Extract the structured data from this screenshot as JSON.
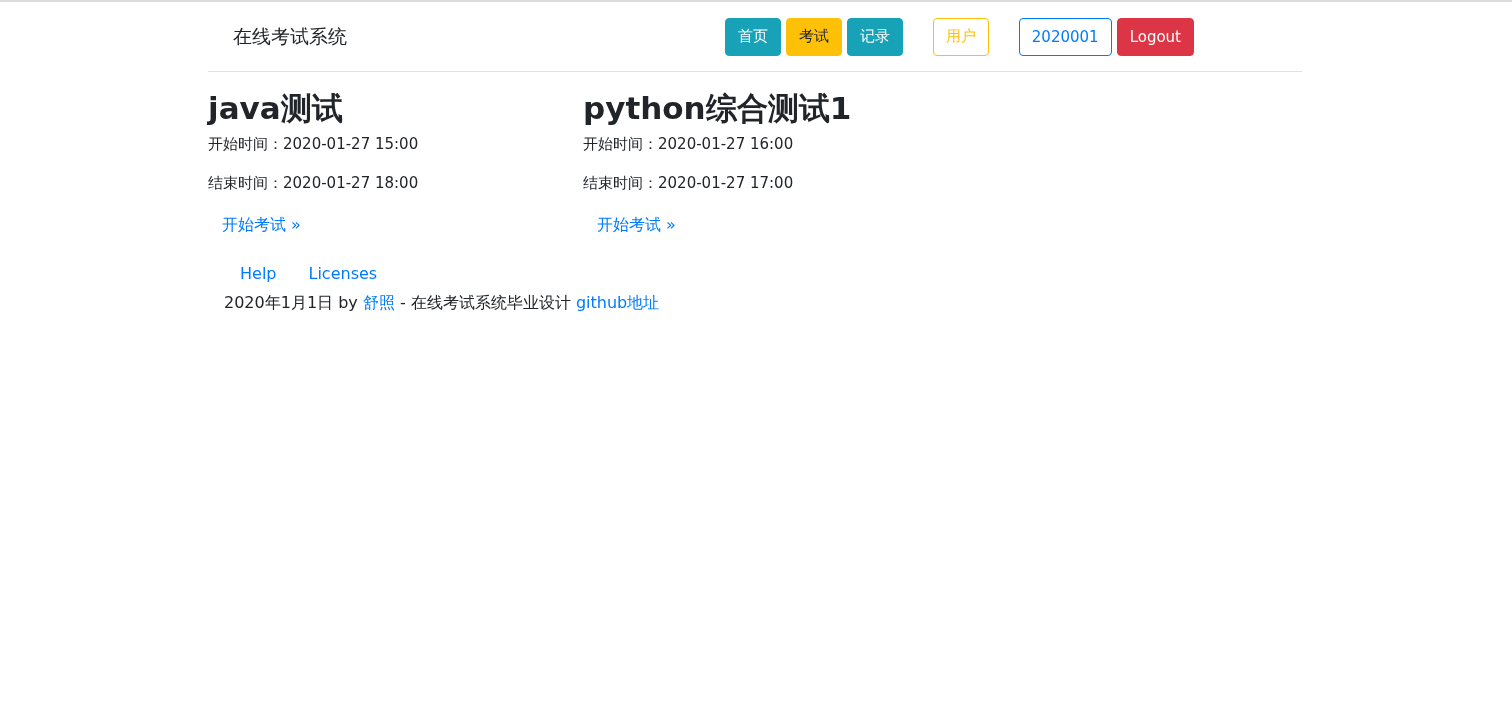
{
  "brand": "在线考试系统",
  "nav_groups": [
    [
      {
        "label": "首页"
      },
      {
        "label": "考试"
      },
      {
        "label": "记录"
      }
    ],
    [
      {
        "label": "用户"
      }
    ],
    [
      {
        "label": "2020001"
      },
      {
        "label": "Logout"
      }
    ]
  ],
  "exams": [
    {
      "title": "java测试",
      "start": "开始时间：2020-01-27 15:00",
      "end": "结束时间：2020-01-27 18:00",
      "action": "开始考试 »"
    },
    {
      "title": "python综合测试1",
      "start": "开始时间：2020-01-27 16:00",
      "end": "结束时间：2020-01-27 17:00",
      "action": "开始考试 »"
    }
  ],
  "footer": {
    "links": [
      "Help",
      "Licenses"
    ],
    "credit": [
      {
        "kind": "text",
        "text": "2020年1月1日 by "
      },
      {
        "kind": "link",
        "text": "舒照"
      },
      {
        "kind": "text",
        "text": " - 在线考试系统毕业设计 "
      },
      {
        "kind": "link",
        "text": "github地址"
      }
    ]
  }
}
